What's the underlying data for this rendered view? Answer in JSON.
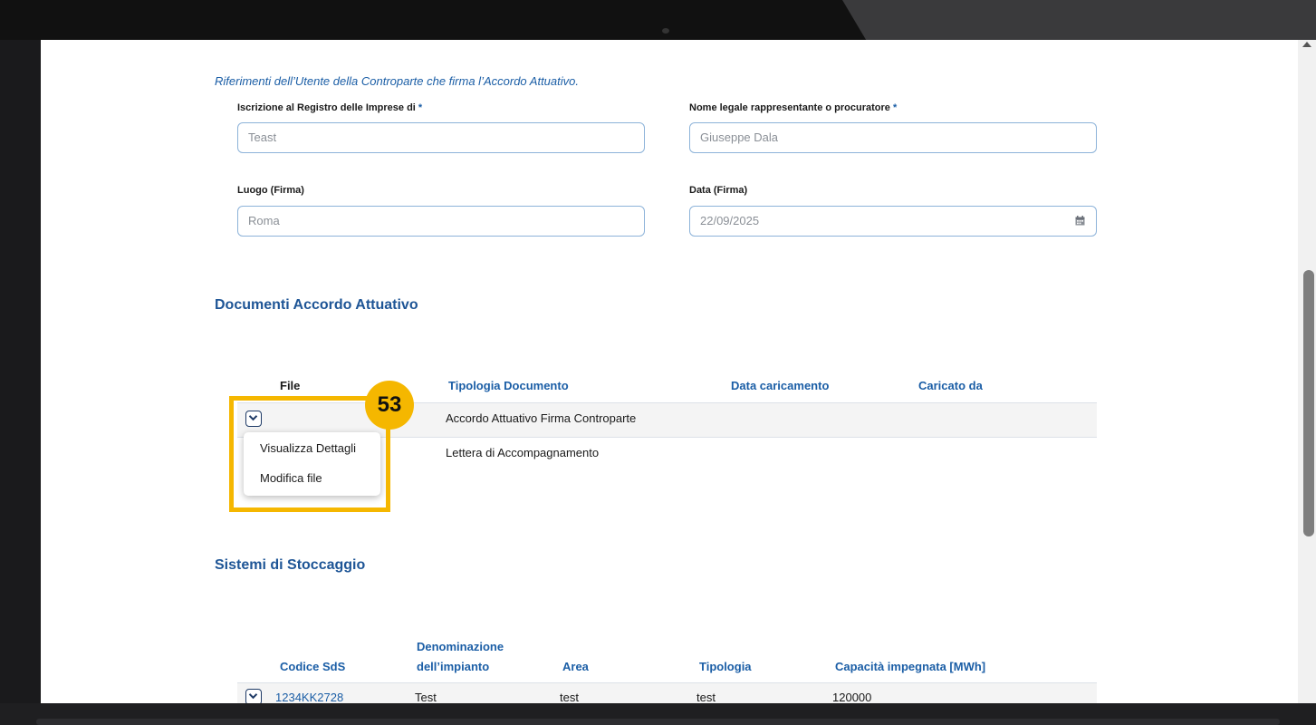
{
  "signatory_section": {
    "intro_text": "Riferimenti dell’Utente della Controparte che firma l’Accordo Attuativo.",
    "registry_label": "Iscrizione al Registro delle Imprese di",
    "registry_value": "Teast",
    "legal_rep_label": "Nome legale rappresentante o procuratore",
    "legal_rep_value": "Giuseppe Dala",
    "place_label": "Luogo (Firma)",
    "place_value": "Roma",
    "date_label": "Data (Firma)",
    "date_value": "22/09/2025",
    "required_mark": "*"
  },
  "documents": {
    "title": "Documenti Accordo Attuativo",
    "columns": [
      "File",
      "Tipologia Documento",
      "Data caricamento",
      "Caricato da"
    ],
    "rows": [
      {
        "type": "Accordo Attuativo Firma Controparte",
        "date": "",
        "uploaded_by": ""
      },
      {
        "type": "Lettera di Accompagnamento",
        "date": "",
        "uploaded_by": ""
      }
    ],
    "menu": [
      "Visualizza Dettagli",
      "Modifica file"
    ]
  },
  "storage": {
    "title": "Sistemi di Stoccaggio",
    "columns": [
      "Codice SdS",
      "Denominazione",
      "dell’impianto",
      "Area",
      "Tipologia",
      "Capacità impegnata [MWh]"
    ],
    "rows": [
      {
        "code": "1234KK2728",
        "name": "Test",
        "area": "test",
        "type": "test",
        "capacity": "120000"
      }
    ]
  },
  "annotation": {
    "step_number": "53",
    "highlight_color": "#f5b700"
  },
  "colors": {
    "accent": "#1b5ea6",
    "section_title": "#1e5596"
  }
}
